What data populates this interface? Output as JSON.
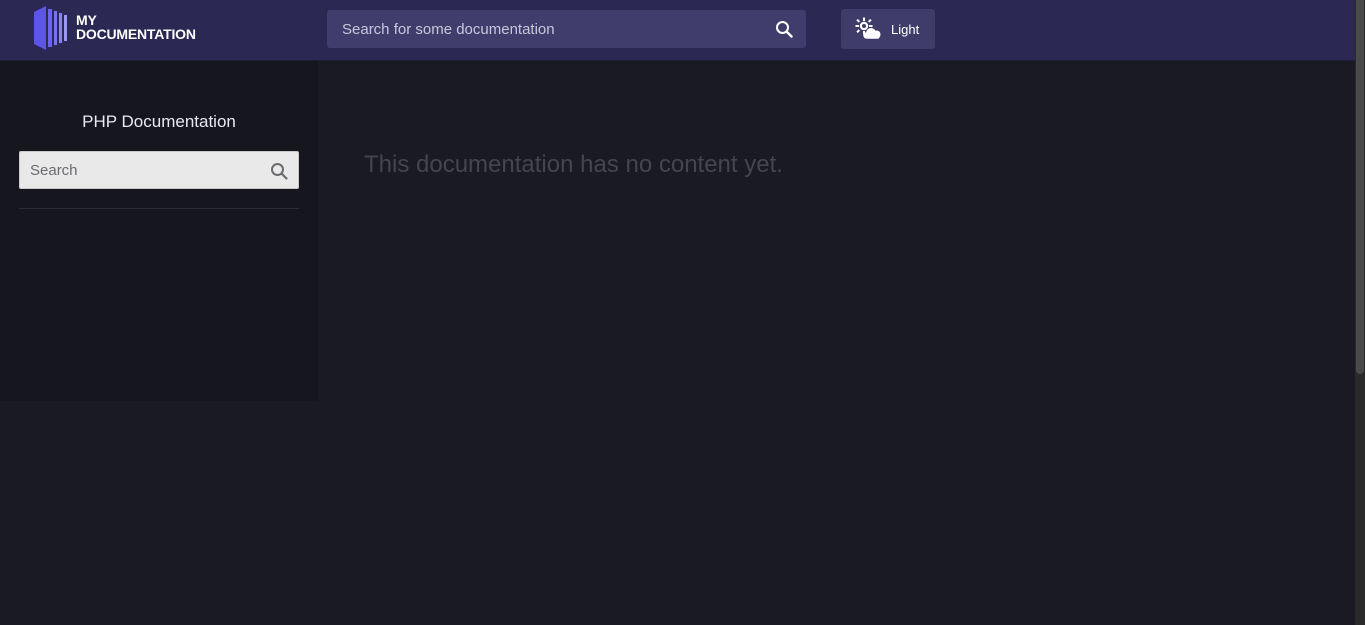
{
  "header": {
    "logo": {
      "line1": "MY",
      "line2": "DOCUMENTATION"
    },
    "search": {
      "placeholder": "Search for some documentation",
      "value": ""
    },
    "theme_toggle": {
      "label": "Light",
      "icon": "weather-sun-cloud-icon"
    }
  },
  "sidebar": {
    "title": "PHP Documentation",
    "search": {
      "placeholder": "Search",
      "value": ""
    }
  },
  "main": {
    "empty_message": "This documentation has no content yet."
  },
  "colors": {
    "header_bg": "#2b2854",
    "search_bg": "#403d6c",
    "accent": "#5b55e8",
    "sidebar_bg": "#16161e",
    "main_bg": "#191a22"
  }
}
